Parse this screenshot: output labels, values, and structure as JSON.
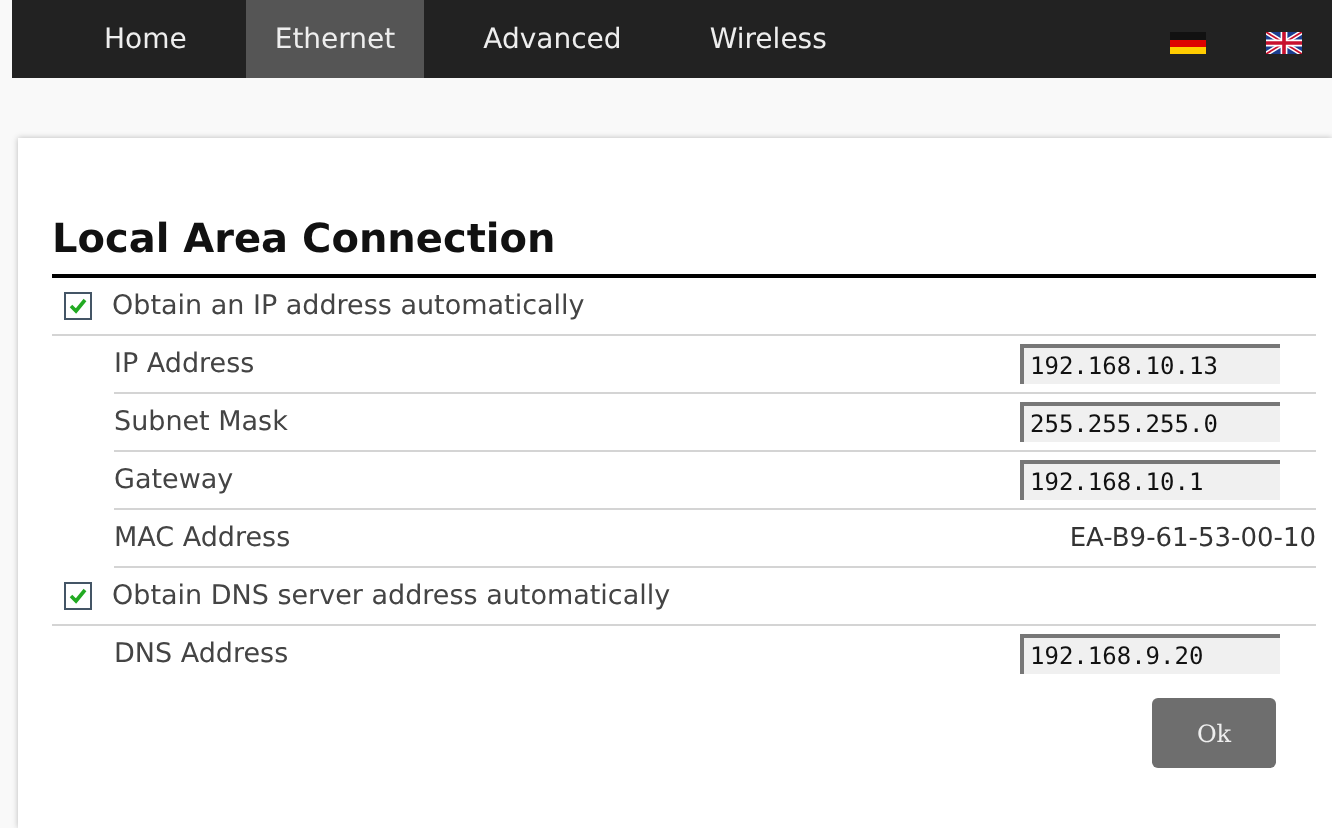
{
  "nav": {
    "tabs": [
      {
        "label": "Home",
        "selected": false
      },
      {
        "label": "Ethernet",
        "selected": true
      },
      {
        "label": "Advanced",
        "selected": false
      },
      {
        "label": "Wireless",
        "selected": false
      }
    ],
    "languages": [
      {
        "kind": "german"
      },
      {
        "kind": "english"
      }
    ]
  },
  "panel": {
    "title": "Local Area Connection",
    "rows": [
      {
        "kind": "checkbox",
        "label": "Obtain an IP address automatically",
        "checked": true
      },
      {
        "kind": "input",
        "label": "IP Address",
        "value": "192.168.10.13"
      },
      {
        "kind": "input",
        "label": "Subnet Mask",
        "value": "255.255.255.0"
      },
      {
        "kind": "input",
        "label": "Gateway",
        "value": "192.168.10.1"
      },
      {
        "kind": "text",
        "label": "MAC Address",
        "value": "EA-B9-61-53-00-10"
      },
      {
        "kind": "checkbox",
        "label": "Obtain DNS server address automatically",
        "checked": true
      },
      {
        "kind": "input",
        "label": "DNS Address",
        "value": "192.168.9.20"
      }
    ],
    "button": "Ok"
  }
}
